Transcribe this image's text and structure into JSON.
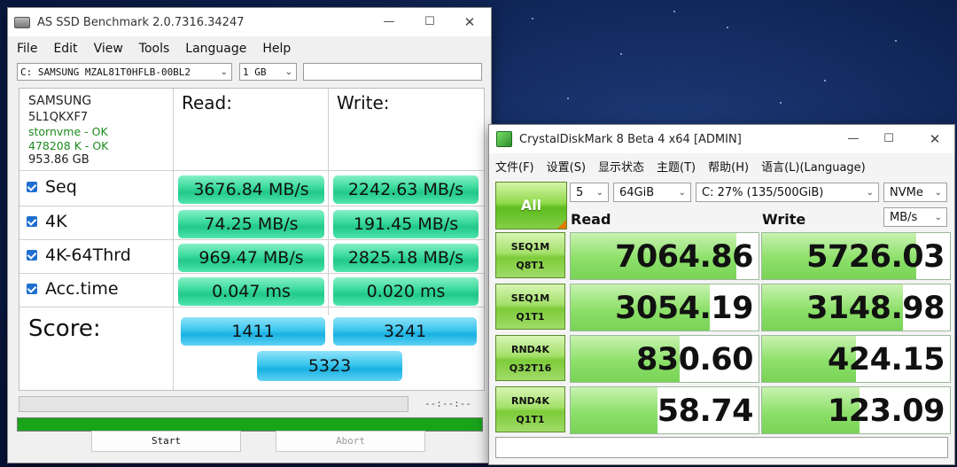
{
  "asssd": {
    "title": "AS SSD Benchmark 2.0.7316.34247",
    "menu": [
      "File",
      "Edit",
      "View",
      "Tools",
      "Language",
      "Help"
    ],
    "drive_select": "C: SAMSUNG MZAL81T0HFLB-00BL2",
    "size_select": "1 GB",
    "device": {
      "vendor": "SAMSUNG",
      "serial": "5L1QKXF7",
      "driver_status": "stornvme - OK",
      "alignment_status": "478208 K - OK",
      "capacity": "953.86 GB"
    },
    "headers": {
      "read": "Read:",
      "write": "Write:"
    },
    "rows": [
      {
        "label": "Seq",
        "read": "3676.84 MB/s",
        "write": "2242.63 MB/s"
      },
      {
        "label": "4K",
        "read": "74.25 MB/s",
        "write": "191.45 MB/s"
      },
      {
        "label": "4K-64Thrd",
        "read": "969.47 MB/s",
        "write": "2825.18 MB/s"
      },
      {
        "label": "Acc.time",
        "read": "0.047 ms",
        "write": "0.020 ms"
      }
    ],
    "score": {
      "label": "Score:",
      "read": "1411",
      "write": "3241",
      "total": "5323"
    },
    "elapsed": "--:--:--",
    "buttons": {
      "start": "Start",
      "abort": "Abort"
    },
    "colors": {
      "green_bar": "#3fdc9f",
      "blue_bar": "#3cc6ee",
      "progress": "#19a319"
    }
  },
  "cdm": {
    "title": "CrystalDiskMark 8 Beta 4 x64 [ADMIN]",
    "menu": [
      "文件(F)",
      "设置(S)",
      "显示状态",
      "主题(T)",
      "帮助(H)",
      "语言(L)(Language)"
    ],
    "all_button": "All",
    "count": "5",
    "size": "64GiB",
    "drive": "C: 27% (135/500GiB)",
    "profile": "NVMe",
    "unit": "MB/s",
    "col_read": "Read",
    "col_write": "Write",
    "tests": [
      {
        "line1": "SEQ1M",
        "line2": "Q8T1",
        "read": "7064.86",
        "write": "5726.03",
        "read_fill": 0.88,
        "write_fill": 0.82
      },
      {
        "line1": "SEQ1M",
        "line2": "Q1T1",
        "read": "3054.19",
        "write": "3148.98",
        "read_fill": 0.74,
        "write_fill": 0.75
      },
      {
        "line1": "RND4K",
        "line2": "Q32T16",
        "read": "830.60",
        "write": "424.15",
        "read_fill": 0.58,
        "write_fill": 0.5
      },
      {
        "line1": "RND4K",
        "line2": "Q1T1",
        "read": "58.74",
        "write": "123.09",
        "read_fill": 0.46,
        "write_fill": 0.52
      }
    ],
    "colors": {
      "bar_fill": "#8de06a",
      "all_button": "#5cbc1e"
    }
  }
}
